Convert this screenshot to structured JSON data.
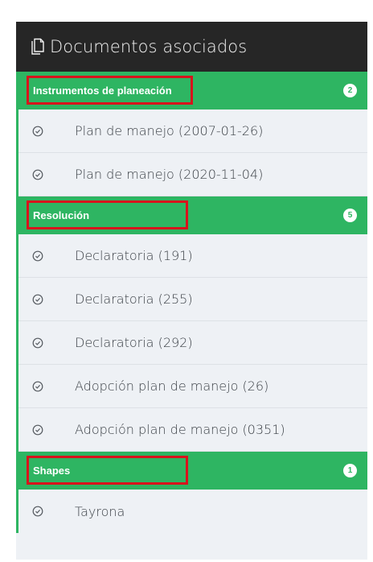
{
  "panel": {
    "title": "Documentos asociados",
    "icon": "documents-icon"
  },
  "colors": {
    "header_bg": "#262626",
    "group_bg": "#2eb562",
    "highlight_border": "#d8131c",
    "item_bg": "#eef1f5"
  },
  "groups": [
    {
      "label": "Instrumentos de planeación",
      "count": "2",
      "items": [
        {
          "label": "Plan de manejo (2007-01-26)",
          "icon": "check-circle-icon"
        },
        {
          "label": "Plan de manejo (2020-11-04)",
          "icon": "check-circle-icon"
        }
      ]
    },
    {
      "label": "Resolución",
      "count": "5",
      "items": [
        {
          "label": "Declaratoria (191)",
          "icon": "check-circle-icon"
        },
        {
          "label": "Declaratoria (255)",
          "icon": "check-circle-icon"
        },
        {
          "label": "Declaratoria (292)",
          "icon": "check-circle-icon"
        },
        {
          "label": "Adopción plan de manejo (26)",
          "icon": "check-circle-icon"
        },
        {
          "label": "Adopción plan de manejo (0351)",
          "icon": "check-circle-icon"
        }
      ]
    },
    {
      "label": "Shapes",
      "count": "1",
      "items": [
        {
          "label": "Tayrona",
          "icon": "check-circle-icon"
        }
      ]
    }
  ]
}
